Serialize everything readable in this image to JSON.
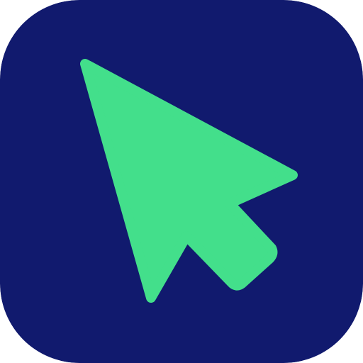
{
  "app_icon": {
    "icon": "mouse-pointer-cursor-icon",
    "colors": {
      "background": "#111a6e",
      "pointer": "#43df8b"
    }
  }
}
